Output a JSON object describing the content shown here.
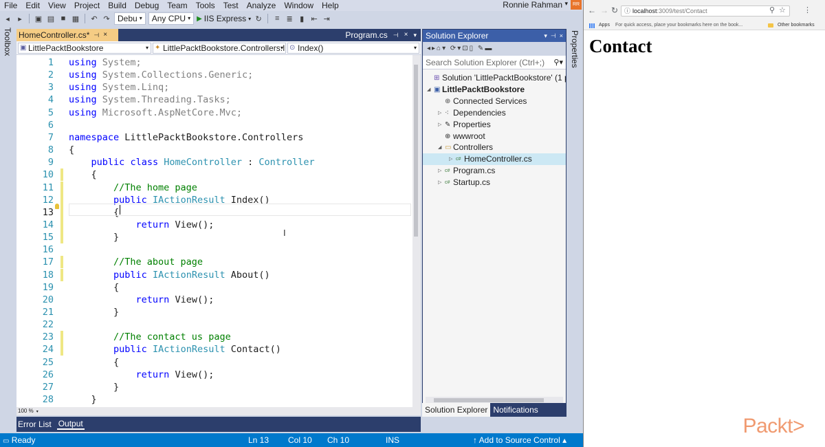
{
  "vs": {
    "menu": [
      "File",
      "Edit",
      "View",
      "Project",
      "Build",
      "Debug",
      "Team",
      "Tools",
      "Test",
      "Analyze",
      "Window",
      "Help"
    ],
    "user": "Ronnie Rahman",
    "toolbar": {
      "config": "Debu",
      "platform": "Any CPU",
      "run_target": "IIS Express"
    },
    "toolbox_label": "Toolbox",
    "properties_label": "Properties",
    "editor": {
      "active_tab": "HomeController.cs*",
      "other_tab": "Program.cs",
      "nav_project": "LittlePacktBookstore",
      "nav_class": "LittlePacktBookstore.Controllers.I",
      "nav_member": "Index()",
      "zoom": "100 %",
      "lines": [
        {
          "n": "1",
          "code": "using System;"
        },
        {
          "n": "2",
          "code": "using System.Collections.Generic;"
        },
        {
          "n": "3",
          "code": "using System.Linq;"
        },
        {
          "n": "4",
          "code": "using System.Threading.Tasks;"
        },
        {
          "n": "5",
          "code": "using Microsoft.AspNetCore.Mvc;"
        },
        {
          "n": "6",
          "code": ""
        },
        {
          "n": "7",
          "code": "namespace LittlePacktBookstore.Controllers"
        },
        {
          "n": "8",
          "code": "{"
        },
        {
          "n": "9",
          "code": "    public class HomeController : Controller"
        },
        {
          "n": "10",
          "code": "    {"
        },
        {
          "n": "11",
          "code": "        //The home page"
        },
        {
          "n": "12",
          "code": "        public IActionResult Index()"
        },
        {
          "n": "13",
          "code": "        {"
        },
        {
          "n": "14",
          "code": "            return View();"
        },
        {
          "n": "15",
          "code": "        }"
        },
        {
          "n": "16",
          "code": ""
        },
        {
          "n": "17",
          "code": "        //The about page"
        },
        {
          "n": "18",
          "code": "        public IActionResult About()"
        },
        {
          "n": "19",
          "code": "        {"
        },
        {
          "n": "20",
          "code": "            return View();"
        },
        {
          "n": "21",
          "code": "        }"
        },
        {
          "n": "22",
          "code": ""
        },
        {
          "n": "23",
          "code": "        //The contact us page"
        },
        {
          "n": "24",
          "code": "        public IActionResult Contact()"
        },
        {
          "n": "25",
          "code": "        {"
        },
        {
          "n": "26",
          "code": "            return View();"
        },
        {
          "n": "27",
          "code": "        }"
        },
        {
          "n": "28",
          "code": "    }"
        }
      ]
    },
    "bottom_tabs": [
      "Error List",
      "Output"
    ],
    "solution_explorer": {
      "title": "Solution Explorer",
      "search_placeholder": "Search Solution Explorer (Ctrl+;)",
      "tree": [
        {
          "label": "Solution 'LittlePacktBookstore' (1 pr",
          "bold": false,
          "selected": false
        },
        {
          "label": "LittlePacktBookstore",
          "bold": true,
          "selected": false
        },
        {
          "label": "Connected Services",
          "bold": false,
          "selected": false
        },
        {
          "label": "Dependencies",
          "bold": false,
          "selected": false
        },
        {
          "label": "Properties",
          "bold": false,
          "selected": false
        },
        {
          "label": "wwwroot",
          "bold": false,
          "selected": false
        },
        {
          "label": "Controllers",
          "bold": false,
          "selected": false
        },
        {
          "label": "HomeController.cs",
          "bold": false,
          "selected": true
        },
        {
          "label": "Program.cs",
          "bold": false,
          "selected": false
        },
        {
          "label": "Startup.cs",
          "bold": false,
          "selected": false
        }
      ],
      "tabs": [
        "Solution Explorer",
        "Notifications"
      ]
    },
    "status": {
      "ready": "Ready",
      "ln": "Ln 13",
      "col": "Col 10",
      "ch": "Ch 10",
      "mode": "INS",
      "source_control": "Add to Source Control"
    }
  },
  "browser": {
    "url_host": "localhost",
    "url_path": ":3009/test/Contact",
    "bookmarks_apps": "Apps",
    "bookmarks_hint": "For quick access, place your bookmarks here on the book...",
    "bookmarks_other": "Other bookmarks",
    "page_heading": "Contact"
  },
  "brand": {
    "logo_text": "Packt>",
    "accent": "#0079cc",
    "logo_color": "#f09a70"
  }
}
